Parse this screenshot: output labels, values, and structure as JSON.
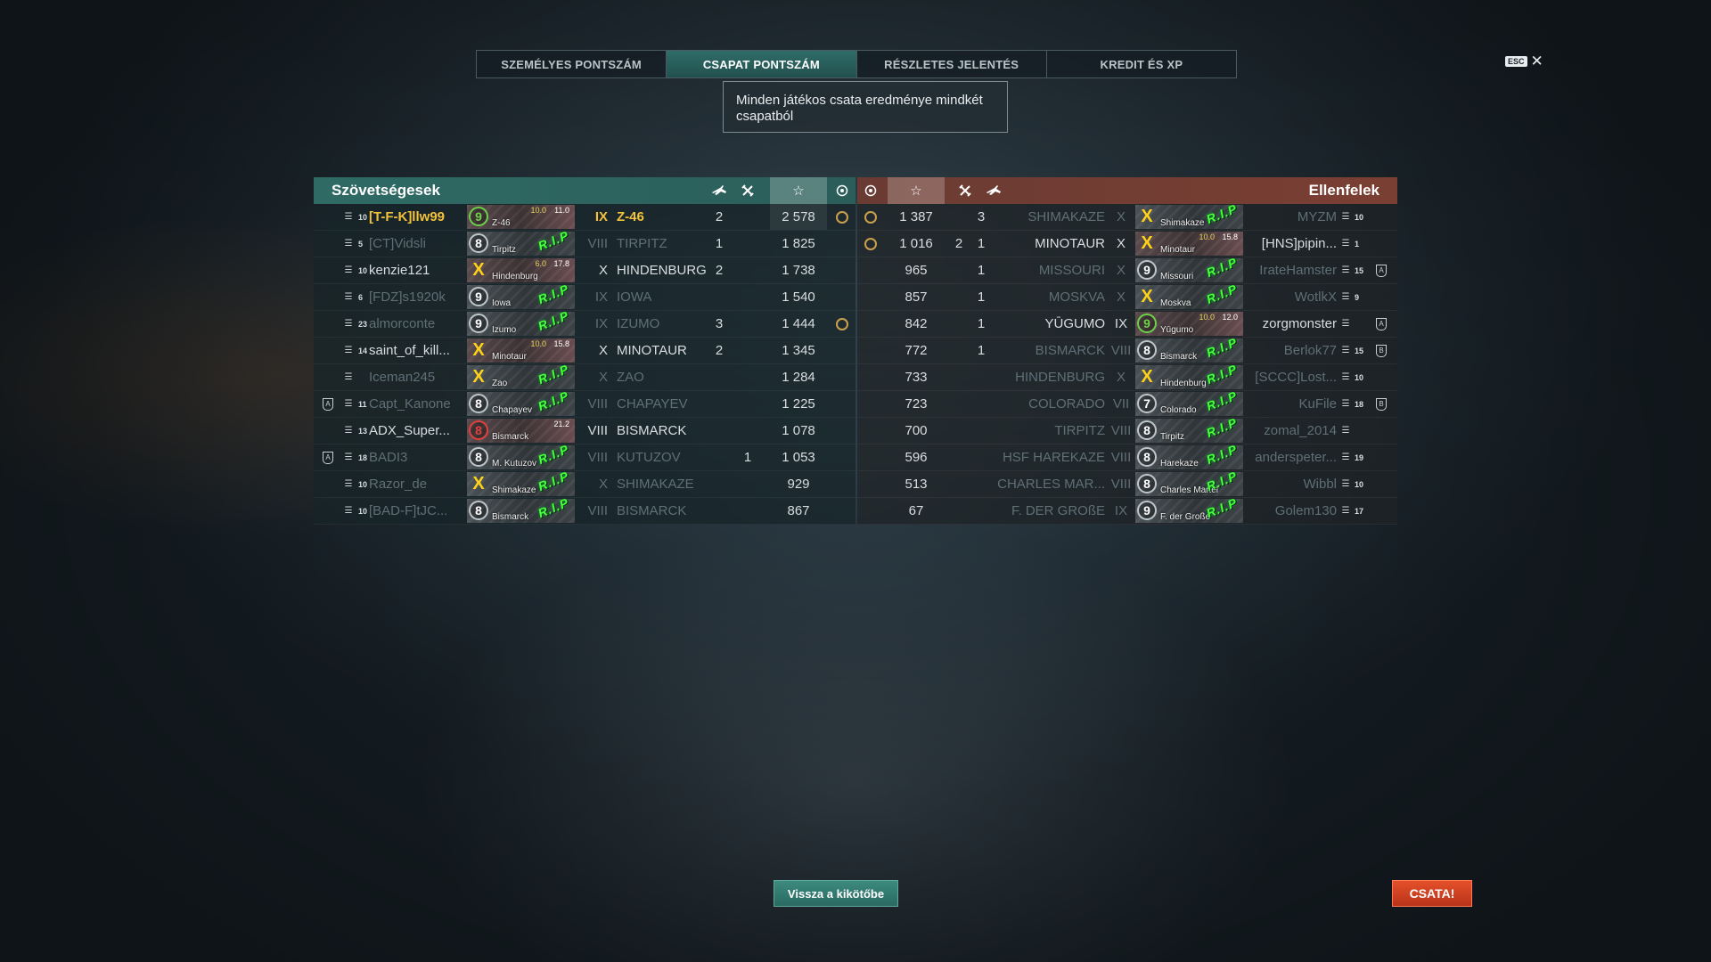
{
  "tabs": [
    {
      "label": "SZEMÉLYES PONTSZÁM"
    },
    {
      "label": "CSAPAT PONTSZÁM"
    },
    {
      "label": "RÉSZLETES JELENTÉS"
    },
    {
      "label": "KREDIT ÉS XP"
    }
  ],
  "active_tab": 1,
  "tooltip": {
    "text": "Minden játékos csata eredménye mindkét csapatból"
  },
  "esc": {
    "key": "ESC",
    "close": "✕"
  },
  "headers": {
    "allies": "Szövetségesek",
    "enemies": "Ellenfelek"
  },
  "header_icons": [
    "plane-icon",
    "ship-kill-icon",
    "star-icon",
    "medal-icon"
  ],
  "allies": [
    {
      "lvl": "10",
      "player": "[T-F-K]llw99",
      "tier": "IX",
      "ship": "Z-46",
      "ship_short": "Z-46",
      "badge": "9",
      "alive": true,
      "planes": "2",
      "kills": "",
      "score": "2 578",
      "medal": true,
      "highlight": true,
      "stat": "11.0",
      "stat2": "10.0"
    },
    {
      "lvl": "5",
      "player": "[CT]Vidsli",
      "tier": "VIII",
      "ship": "TIRPITZ",
      "ship_short": "Tirpitz",
      "badge": "8",
      "alive": false,
      "planes": "1",
      "kills": "",
      "score": "1 825",
      "medal": false
    },
    {
      "lvl": "10",
      "player": "kenzie121",
      "tier": "X",
      "ship": "HINDENBURG",
      "ship_short": "Hindenburg",
      "badge": "X",
      "alive": true,
      "planes": "2",
      "kills": "",
      "score": "1 738",
      "medal": false,
      "stat": "17.8",
      "stat2": "6.0"
    },
    {
      "lvl": "6",
      "player": "[FDZ]s1920k",
      "tier": "IX",
      "ship": "IOWA",
      "ship_short": "Iowa",
      "badge": "9",
      "alive": false,
      "planes": "",
      "kills": "",
      "score": "1 540",
      "medal": false
    },
    {
      "lvl": "23",
      "player": "almorconte",
      "tier": "IX",
      "ship": "IZUMO",
      "ship_short": "Izumo",
      "badge": "9",
      "alive": false,
      "planes": "3",
      "kills": "",
      "score": "1 444",
      "medal": true
    },
    {
      "lvl": "14",
      "player": "saint_of_kill...",
      "tier": "X",
      "ship": "MINOTAUR",
      "ship_short": "Minotaur",
      "badge": "X",
      "alive": true,
      "planes": "2",
      "kills": "",
      "score": "1 345",
      "medal": false,
      "stat": "15.8",
      "stat2": "10.0"
    },
    {
      "lvl": "",
      "player": "Iceman245",
      "tier": "X",
      "ship": "ZAO",
      "ship_short": "Zao",
      "badge": "X",
      "alive": false,
      "planes": "",
      "kills": "",
      "score": "1 284",
      "medal": false
    },
    {
      "lvl": "11",
      "player": "Capt_Kanone",
      "tier": "VIII",
      "ship": "CHAPAYEV",
      "ship_short": "Chapayev",
      "badge": "8",
      "alive": false,
      "planes": "",
      "kills": "",
      "score": "1 225",
      "medal": false,
      "division": "A"
    },
    {
      "lvl": "13",
      "player": "ADX_Super...",
      "tier": "VIII",
      "ship": "BISMARCK",
      "ship_short": "Bismarck",
      "badge": "8",
      "alive": true,
      "red": true,
      "planes": "",
      "kills": "",
      "score": "1 078",
      "medal": false,
      "stat": "21.2"
    },
    {
      "lvl": "18",
      "player": "BADI3",
      "tier": "VIII",
      "ship": "KUTUZOV",
      "ship_short": "M. Kutuzov",
      "badge": "8",
      "alive": false,
      "planes": "",
      "kills": "1",
      "score": "1 053",
      "medal": false,
      "division": "A"
    },
    {
      "lvl": "10",
      "player": "Razor_de",
      "tier": "X",
      "ship": "SHIMAKAZE",
      "ship_short": "Shimakaze",
      "badge": "X",
      "alive": false,
      "planes": "",
      "kills": "",
      "score": "929",
      "medal": false
    },
    {
      "lvl": "10",
      "player": "[BAD-F]tJC...",
      "tier": "VIII",
      "ship": "BISMARCK",
      "ship_short": "Bismarck",
      "badge": "8",
      "alive": false,
      "planes": "",
      "kills": "",
      "score": "867",
      "medal": false
    }
  ],
  "enemies": [
    {
      "lvl": "10",
      "player": "MYZM",
      "tier": "X",
      "ship": "SHIMAKAZE",
      "ship_short": "Shimakaze",
      "badge": "X",
      "alive": false,
      "planes": "3",
      "kills": "",
      "score": "1 387",
      "medal": true
    },
    {
      "lvl": "1",
      "player": "[HNS]pipin...",
      "tier": "X",
      "ship": "MINOTAUR",
      "ship_short": "Minotaur",
      "badge": "X",
      "alive": true,
      "planes": "1",
      "kills": "2",
      "score": "1 016",
      "medal": true,
      "stat": "15.8",
      "stat2": "10.0"
    },
    {
      "lvl": "15",
      "player": "IrateHamster",
      "tier": "X",
      "ship": "MISSOURI",
      "ship_short": "Missouri",
      "badge": "9",
      "alive": false,
      "planes": "1",
      "kills": "",
      "score": "965",
      "medal": false,
      "division": "A"
    },
    {
      "lvl": "9",
      "player": "WotlkX",
      "tier": "X",
      "ship": "MOSKVA",
      "ship_short": "Moskva",
      "badge": "X",
      "alive": false,
      "planes": "1",
      "kills": "",
      "score": "857",
      "medal": false
    },
    {
      "lvl": "",
      "player": "zorgmonster",
      "tier": "IX",
      "ship": "YŪGUMO",
      "ship_short": "Yūgumo",
      "badge": "9",
      "alive": true,
      "planes": "1",
      "kills": "",
      "score": "842",
      "medal": false,
      "stat": "12.0",
      "stat2": "10.0",
      "division": "A"
    },
    {
      "lvl": "15",
      "player": "Berlok77",
      "tier": "VIII",
      "ship": "BISMARCK",
      "ship_short": "Bismarck",
      "badge": "8",
      "alive": false,
      "planes": "1",
      "kills": "",
      "score": "772",
      "medal": false,
      "division": "B"
    },
    {
      "lvl": "10",
      "player": "[SCCC]Lost...",
      "tier": "X",
      "ship": "HINDENBURG",
      "ship_short": "Hindenburg",
      "badge": "X",
      "alive": false,
      "planes": "",
      "kills": "",
      "score": "733",
      "medal": false
    },
    {
      "lvl": "18",
      "player": "KuFile",
      "tier": "VII",
      "ship": "COLORADO",
      "ship_short": "Colorado",
      "badge": "7",
      "alive": false,
      "planes": "",
      "kills": "",
      "score": "723",
      "medal": false,
      "division": "B"
    },
    {
      "lvl": "",
      "player": "zomal_2014",
      "tier": "VIII",
      "ship": "TIRPITZ",
      "ship_short": "Tirpitz",
      "badge": "8",
      "alive": false,
      "planes": "",
      "kills": "",
      "score": "700",
      "medal": false
    },
    {
      "lvl": "19",
      "player": "anderspeter...",
      "tier": "VIII",
      "ship": "HSF HAREKAZE",
      "ship_short": "Harekaze",
      "badge": "8",
      "alive": false,
      "planes": "",
      "kills": "",
      "score": "596",
      "medal": false
    },
    {
      "lvl": "10",
      "player": "Wibbl",
      "tier": "VIII",
      "ship": "CHARLES MAR...",
      "ship_short": "Charles Martel",
      "badge": "8",
      "alive": false,
      "planes": "",
      "kills": "",
      "score": "513",
      "medal": false
    },
    {
      "lvl": "17",
      "player": "Golem130",
      "tier": "IX",
      "ship": "F. DER GROßE",
      "ship_short": "F. der Große",
      "badge": "9",
      "alive": false,
      "planes": "",
      "kills": "",
      "score": "67",
      "medal": false
    }
  ],
  "buttons": {
    "back": "Vissza a kikötőbe",
    "battle": "CSATA!"
  },
  "rip_label": "R.I.P"
}
